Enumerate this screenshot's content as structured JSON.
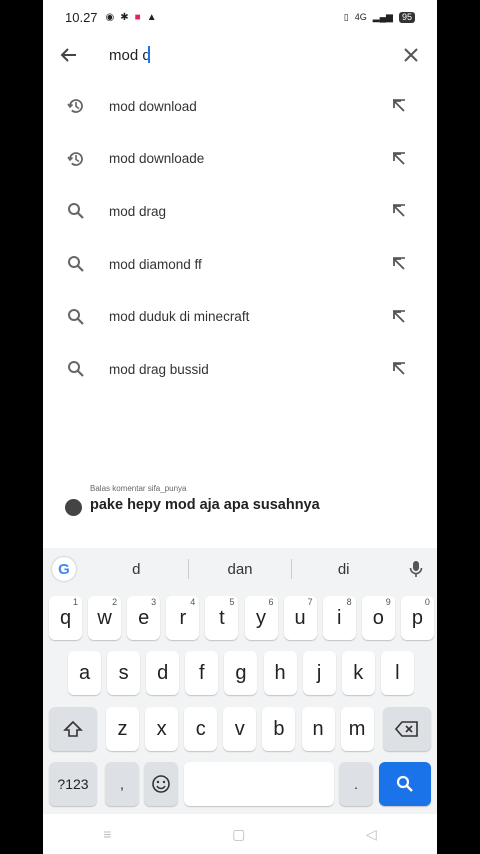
{
  "status": {
    "time": "10.27",
    "left_icons": [
      "circle-icon",
      "gear-icon",
      "app-icon",
      "warning-icon"
    ],
    "signal": "4G",
    "battery": "95"
  },
  "search": {
    "query": "mod d"
  },
  "suggestions": [
    {
      "text": "mod download",
      "type": "history"
    },
    {
      "text": "mod downloade",
      "type": "history"
    },
    {
      "text": "mod drag",
      "type": "search"
    },
    {
      "text": "mod diamond ff",
      "type": "search"
    },
    {
      "text": "mod duduk di minecraft",
      "type": "search"
    },
    {
      "text": "mod drag bussid",
      "type": "search"
    }
  ],
  "comment": {
    "reply_label": "Balas komentar sifa_punya",
    "text": "pake hepy mod aja apa susahnya"
  },
  "keyboard": {
    "word_suggestions": [
      "d",
      "dan",
      "di"
    ],
    "row1": [
      {
        "k": "q",
        "n": "1"
      },
      {
        "k": "w",
        "n": "2"
      },
      {
        "k": "e",
        "n": "3"
      },
      {
        "k": "r",
        "n": "4"
      },
      {
        "k": "t",
        "n": "5"
      },
      {
        "k": "y",
        "n": "6"
      },
      {
        "k": "u",
        "n": "7"
      },
      {
        "k": "i",
        "n": "8"
      },
      {
        "k": "o",
        "n": "9"
      },
      {
        "k": "p",
        "n": "0"
      }
    ],
    "row2": [
      "a",
      "s",
      "d",
      "f",
      "g",
      "h",
      "j",
      "k",
      "l"
    ],
    "row3": [
      "z",
      "x",
      "c",
      "v",
      "b",
      "n",
      "m"
    ],
    "symbols_label": "?123",
    "comma": ",",
    "period": ".",
    "accent_color": "#1a73e8"
  }
}
